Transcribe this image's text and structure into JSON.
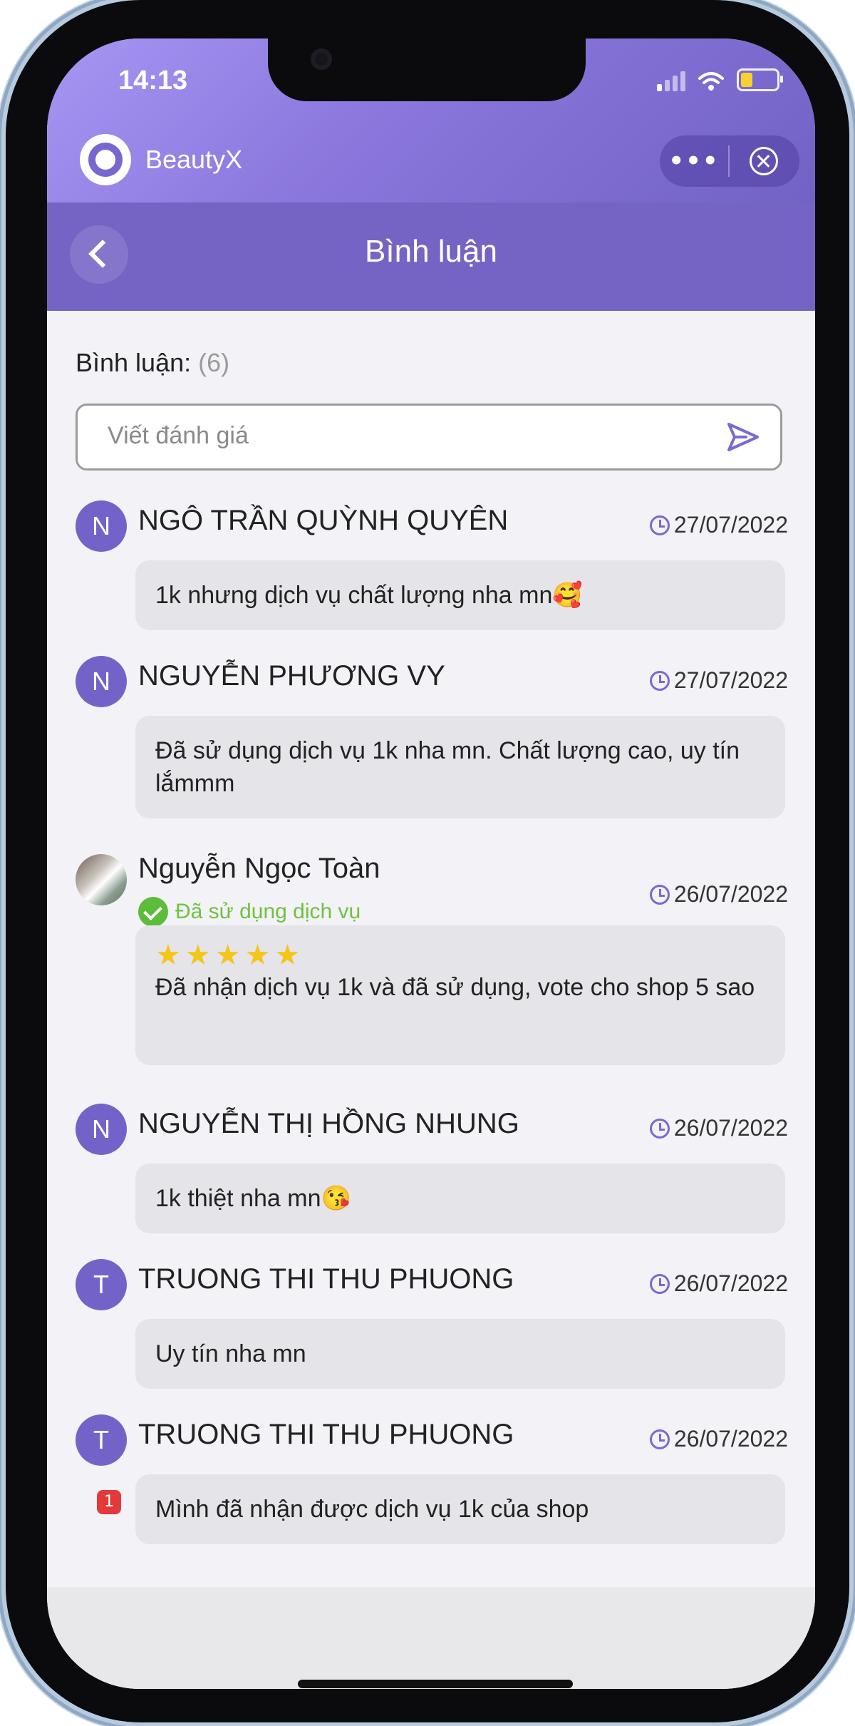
{
  "status": {
    "time": "14:13"
  },
  "miniapp": {
    "name": "BeautyX",
    "more_label": "•••"
  },
  "header": {
    "title": "Bình luận"
  },
  "comments_section": {
    "label": "Bình luận:",
    "count": "(6)",
    "input_placeholder": "Viết đánh giá"
  },
  "comments": [
    {
      "initial": "N",
      "name": "NGÔ TRẦN QUỲNH QUYÊN",
      "date": "27/07/2022",
      "text": "1k nhưng dịch vụ chất lượng nha mn🥰"
    },
    {
      "initial": "N",
      "name": "NGUYỄN PHƯƠNG VY",
      "date": "27/07/2022",
      "text": "Đã sử dụng dịch vụ 1k nha mn. Chất lượng cao, uy tín lắmmm"
    },
    {
      "initial": "",
      "name": "Nguyễn Ngọc Toàn",
      "date": "26/07/2022",
      "verified": "Đã sử dụng dịch vụ",
      "stars": "★★★★★",
      "rating": 5,
      "text": "Đã nhận dịch vụ 1k và đã sử dụng, vote cho shop 5 sao"
    },
    {
      "initial": "N",
      "name": "NGUYỄN THỊ HỒNG NHUNG",
      "date": "26/07/2022",
      "text": "1k thiệt nha mn😘"
    },
    {
      "initial": "T",
      "name": "TRUONG THI THU PHUONG",
      "date": "26/07/2022",
      "text": "Uy tín nha mn"
    },
    {
      "initial": "T",
      "name": "TRUONG THI THU PHUONG",
      "date": "26/07/2022",
      "text": "Mình đã nhận được dịch vụ 1k của shop",
      "badge": "1"
    }
  ],
  "colors": {
    "primary": "#7664c4",
    "verified": "#5dbd3a",
    "star": "#f5c518"
  }
}
